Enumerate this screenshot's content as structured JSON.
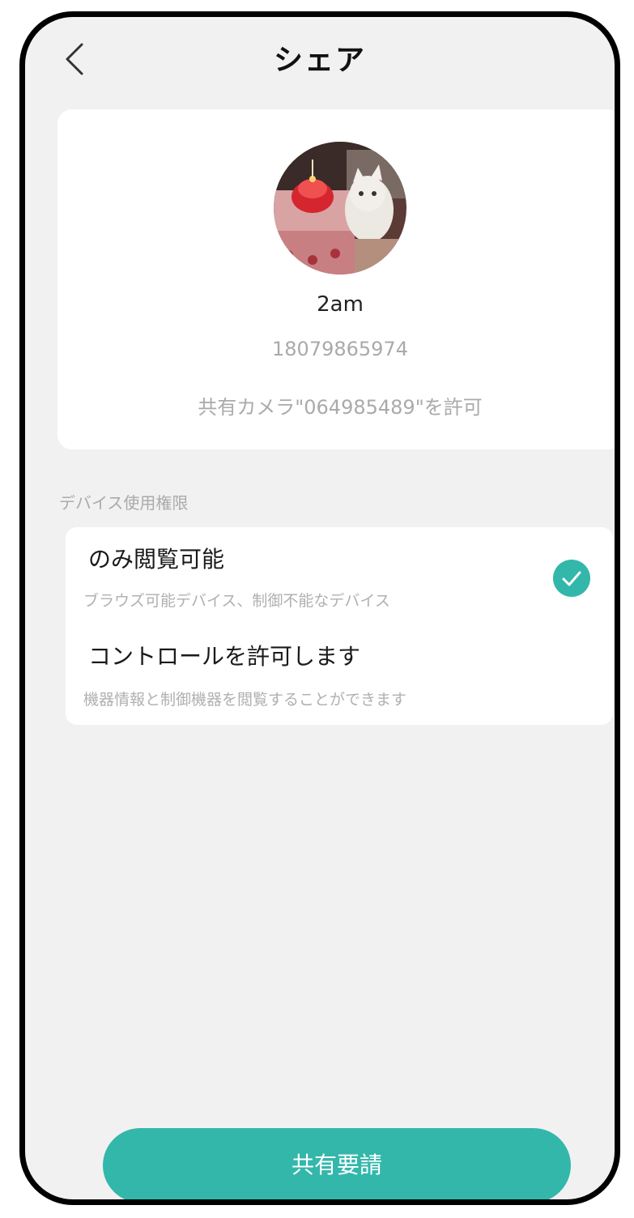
{
  "header": {
    "title": "シェア",
    "back_icon": "chevron-left-icon"
  },
  "profile": {
    "name": "2am",
    "phone": "18079865974",
    "share_note": "共有カメラ\"064985489\"を許可",
    "avatar": "avatar-photo"
  },
  "permissions": {
    "section_label": "デバイス使用権限",
    "options": [
      {
        "title": "のみ閲覧可能",
        "description": "ブラウズ可能デバイス、制御不能なデバイス",
        "selected": true
      },
      {
        "title": "コントロールを許可します",
        "description": "機器情報と制御機器を閲覧することができます",
        "selected": false
      }
    ],
    "check_icon": "check-circle-icon"
  },
  "footer": {
    "request_label": "共有要請"
  },
  "colors": {
    "accent": "#33b7ab",
    "background": "#f1f1f1",
    "card": "#ffffff"
  }
}
